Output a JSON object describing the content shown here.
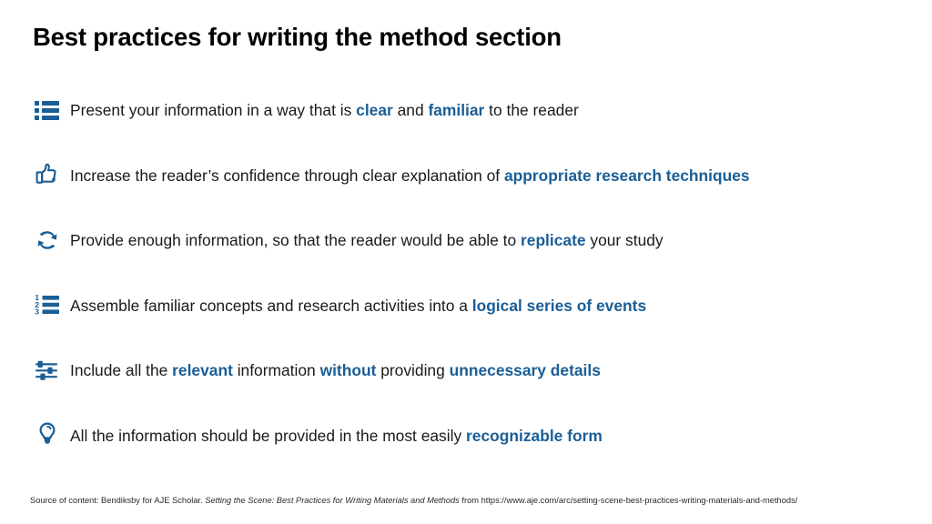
{
  "slide": {
    "title": "Best practices for writing the method section",
    "accent_color": "#1a5e96",
    "text_color": "#1a1a1a",
    "background_color": "#ffffff"
  },
  "bullets": [
    {
      "icon": "bulleted-list-icon",
      "segments": [
        {
          "text": "Present your information in a way that is ",
          "emphasis": false
        },
        {
          "text": "clear",
          "emphasis": true
        },
        {
          "text": " and ",
          "emphasis": false
        },
        {
          "text": "familiar",
          "emphasis": true
        },
        {
          "text": " to the reader",
          "emphasis": false
        }
      ]
    },
    {
      "icon": "thumbs-up-icon",
      "segments": [
        {
          "text": "Increase the reader’s confidence through clear explanation of ",
          "emphasis": false
        },
        {
          "text": "appropriate research techniques",
          "emphasis": true
        }
      ]
    },
    {
      "icon": "refresh-cycle-icon",
      "segments": [
        {
          "text": "Provide enough information, so that the reader would be able to ",
          "emphasis": false
        },
        {
          "text": "replicate",
          "emphasis": true
        },
        {
          "text": " your study",
          "emphasis": false
        }
      ]
    },
    {
      "icon": "numbered-list-icon",
      "segments": [
        {
          "text": "Assemble familiar concepts and research activities into a ",
          "emphasis": false
        },
        {
          "text": "logical series of events",
          "emphasis": true
        }
      ]
    },
    {
      "icon": "sliders-settings-icon",
      "segments": [
        {
          "text": "Include all the ",
          "emphasis": false
        },
        {
          "text": "relevant",
          "emphasis": true
        },
        {
          "text": " information ",
          "emphasis": false
        },
        {
          "text": "without",
          "emphasis": true
        },
        {
          "text": " providing ",
          "emphasis": false
        },
        {
          "text": "unnecessary details",
          "emphasis": true
        }
      ]
    },
    {
      "icon": "lightbulb-icon",
      "segments": [
        {
          "text": "All the information should be provided in the most easily ",
          "emphasis": false
        },
        {
          "text": "recognizable form",
          "emphasis": true
        }
      ]
    }
  ],
  "footnote": {
    "prefix": "Source of content: Bendiksby for AJE Scholar. ",
    "title_italic": "Setting the Scene: Best Practices for Writing Materials and Methods",
    "suffix": " from https://www.aje.com/arc/setting-scene-best-practices-writing-materials-and-methods/"
  }
}
